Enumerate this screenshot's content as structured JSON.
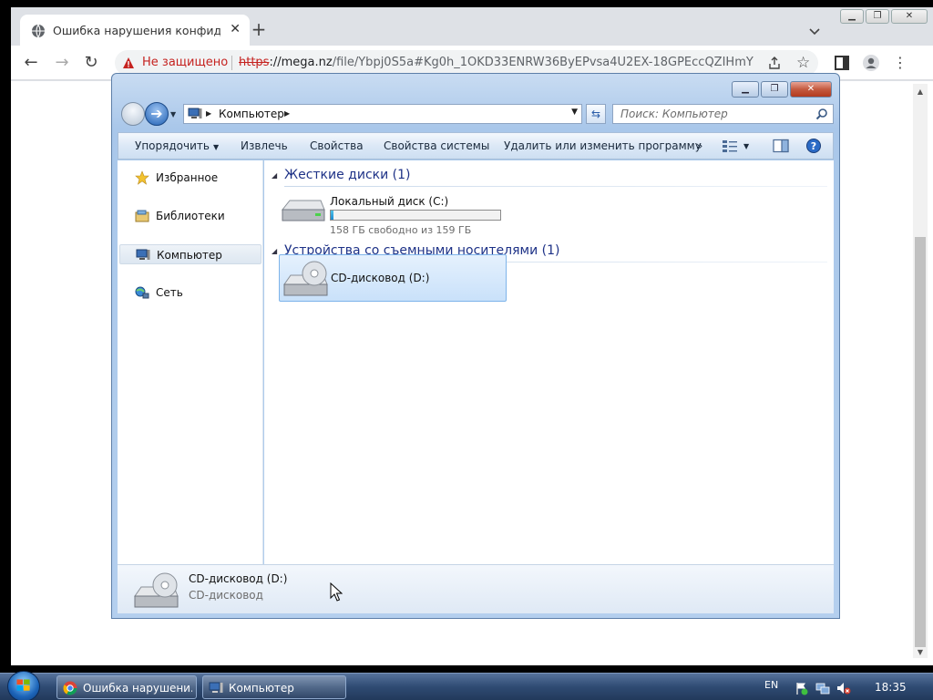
{
  "browser": {
    "tab_title": "Ошибка нарушения конфиденц",
    "security_text": "Не защищено",
    "url_scheme": "https",
    "url_host": "://mega.nz",
    "url_path": "/file/Ybpj0S5a#Kg0h_1OKD33ENRW36ByEPvsa4U2EX-18GPEccQZIHmY"
  },
  "explorer": {
    "breadcrumb": "Компьютер",
    "search_placeholder": "Поиск: Компьютер",
    "commands": {
      "organize": "Упорядочить",
      "eject": "Извлечь",
      "properties": "Свойства",
      "system_properties": "Свойства системы",
      "uninstall": "Удалить или изменить программу",
      "more": "»"
    },
    "nav": {
      "favorites": "Избранное",
      "libraries": "Библиотеки",
      "computer": "Компьютер",
      "network": "Сеть"
    },
    "groups": {
      "hard_disks": "Жесткие диски (1)",
      "removable": "Устройства со съемными носителями (1)"
    },
    "local_disk": {
      "name": "Локальный диск (C:)",
      "free_text": "158 ГБ свободно из 159 ГБ",
      "used_fraction": 0.01
    },
    "cd_drive": {
      "name": "CD-дисковод (D:)"
    },
    "details": {
      "name": "CD-дисковод (D:)",
      "type": "CD-дисковод"
    }
  },
  "taskbar": {
    "task_browser": "Ошибка нарушени...",
    "task_explorer": "Компьютер",
    "language": "EN",
    "clock": "18:35"
  }
}
